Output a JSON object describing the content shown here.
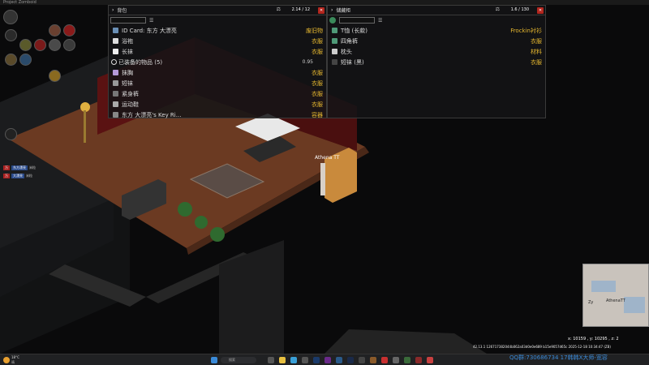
{
  "window": {
    "title": "Project Zomboid"
  },
  "inventory": {
    "title": "背包",
    "weight": "2.14 / 12",
    "items": [
      {
        "name": "ID Card: 东方 大漂亮",
        "category": "废旧物",
        "color": "#6a8fb5"
      },
      {
        "name": "浴袍",
        "category": "衣服",
        "color": "#ddd"
      },
      {
        "name": "长袜",
        "category": "衣服",
        "color": "#eee"
      },
      {
        "name": "抹胸",
        "category": "衣服",
        "color": "#b59ad8"
      },
      {
        "name": "短袜",
        "category": "衣服",
        "color": "#999"
      },
      {
        "name": "紧身裤",
        "category": "衣服",
        "color": "#777"
      },
      {
        "name": "运动鞋",
        "category": "衣服",
        "color": "#aaa"
      },
      {
        "name": "东方 大漂亮's Key Ri...",
        "category": "容器",
        "color": "#888"
      }
    ],
    "equipped_label": "已装备的物品 (5)",
    "equipped_weight": "0.95"
  },
  "container": {
    "title": "储藏柜",
    "weight": "1.6 / 130",
    "items": [
      {
        "name": "T恤 (长款)",
        "category": "Frockin衬衫",
        "color": "#4f9a78"
      },
      {
        "name": "四角裤",
        "category": "衣服",
        "color": "#4f9a78"
      },
      {
        "name": "枕头",
        "category": "材料",
        "color": "#ccc"
      },
      {
        "name": "短袜 (黑)",
        "category": "衣服",
        "color": "#444"
      }
    ]
  },
  "player": {
    "name": "Athena TT"
  },
  "minimap": {
    "player_label": "AthenaTT",
    "other_label": "Zy"
  },
  "coords": {
    "readout": "x: 10159 , y: 10295 , z: 2"
  },
  "version_line": "42.13.1 126717382044b062a03d0e0e689 b15e9057d65c 2025-12-18 10:34:47 (ZB)",
  "watermark": "QQ群:730686734  17韩韩X大师-宽容",
  "taskbar": {
    "weather_temp": "18°C",
    "weather_desc": "晴",
    "search_placeholder": "搜索"
  },
  "party": [
    {
      "tag": "万",
      "label": "东方漂亮",
      "level": "米粒"
    },
    {
      "tag": "万",
      "label": "大漂亮",
      "level": "米粒"
    }
  ]
}
